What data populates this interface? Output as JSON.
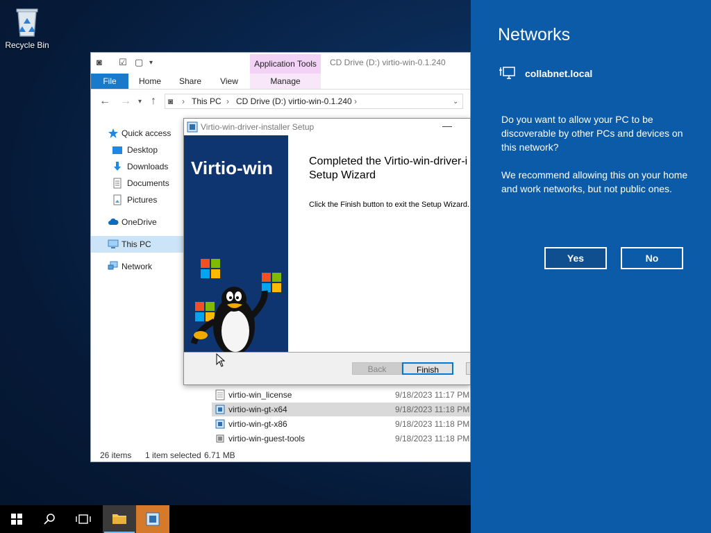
{
  "desktop": {
    "recycle_bin_label": "Recycle Bin"
  },
  "explorer": {
    "app_tools_header": "Application Tools",
    "window_title": "CD Drive (D:) virtio-win-0.1.240",
    "tabs": [
      "File",
      "Home",
      "Share",
      "View",
      "Manage"
    ],
    "breadcrumb": [
      "This PC",
      "CD Drive (D:) virtio-win-0.1.240"
    ],
    "nav": [
      {
        "label": "Quick access",
        "icon": "star-icon"
      },
      {
        "label": "Desktop",
        "icon": "desktop-folder-icon"
      },
      {
        "label": "Downloads",
        "icon": "download-icon"
      },
      {
        "label": "Documents",
        "icon": "document-icon"
      },
      {
        "label": "Pictures",
        "icon": "picture-icon"
      },
      {
        "label": "OneDrive",
        "icon": "cloud-icon"
      },
      {
        "label": "This PC",
        "icon": "computer-icon"
      },
      {
        "label": "Network",
        "icon": "network-icon"
      }
    ],
    "files": [
      {
        "name": "virtio-win_license",
        "date": "9/18/2023 11:17 PM"
      },
      {
        "name": "virtio-win-gt-x64",
        "date": "9/18/2023 11:18 PM"
      },
      {
        "name": "virtio-win-gt-x86",
        "date": "9/18/2023 11:18 PM"
      },
      {
        "name": "virtio-win-guest-tools",
        "date": "9/18/2023 11:18 PM"
      }
    ],
    "status": {
      "items": "26 items",
      "selected": "1 item selected",
      "size": "6.71 MB"
    }
  },
  "setup": {
    "title": "Virtio-win-driver-installer Setup",
    "banner_text": "Virtio-win",
    "heading_line1": "Completed the Virtio-win-driver-i",
    "heading_line2": "Setup Wizard",
    "body": "Click the Finish button to exit the Setup Wizard.",
    "back_label": "Back",
    "finish_label": "Finish"
  },
  "networks": {
    "title": "Networks",
    "network_name": "collabnet.local",
    "question": "Do you want to allow your PC to be discoverable by other PCs and devices on this network?",
    "recommendation": "We recommend allowing this on your home and work networks, but not public ones.",
    "yes_label": "Yes",
    "no_label": "No"
  },
  "colors": {
    "flyout_bg": "#0b5ba8",
    "file_tab": "#1979ca",
    "app_tools": "#f2d3f6",
    "banner": "#0f3570"
  }
}
